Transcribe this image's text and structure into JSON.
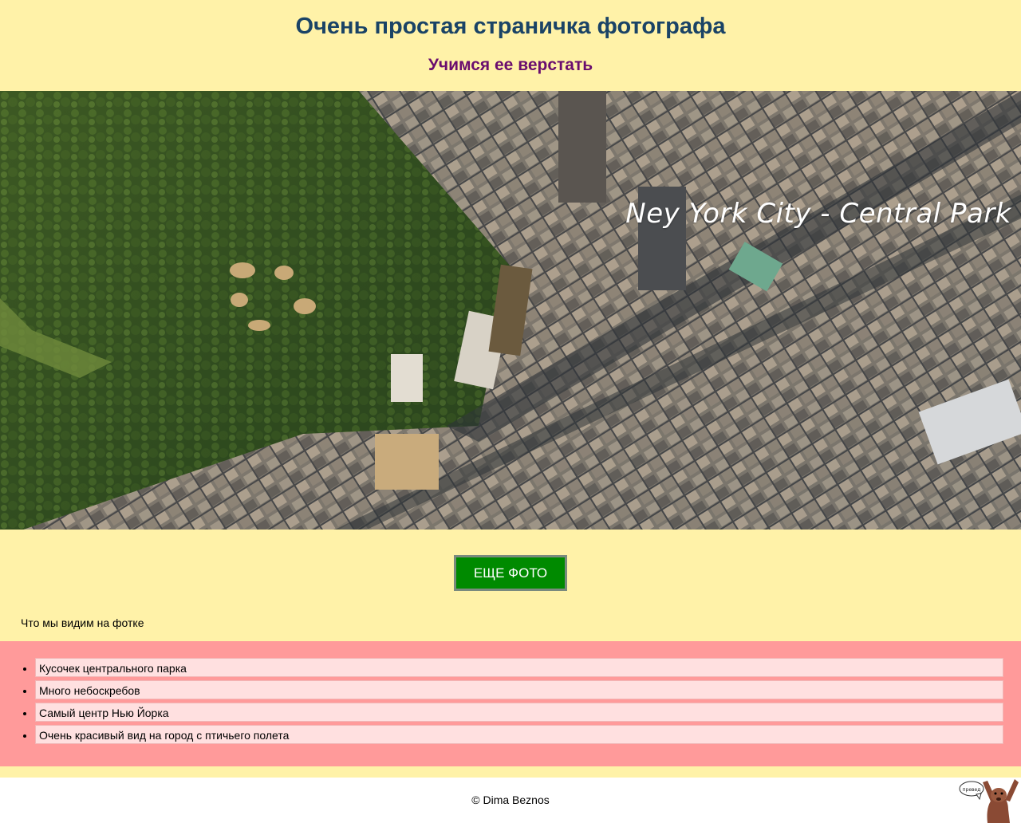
{
  "header": {
    "title": "Очень простая страничка фотографа",
    "subtitle": "Учимся ее верстать"
  },
  "hero": {
    "caption": "Ney York City - Central Park"
  },
  "actions": {
    "more_photos_label": "ЕЩЕ ФОТО"
  },
  "description": {
    "heading": "Что мы видим на фотке",
    "items": [
      "Кусочек центрального парка",
      "Много небоскребов",
      "Самый центр Нью Йорка",
      "Очень красивый вид на город с птичьего полета"
    ]
  },
  "footer": {
    "copyright": "© Dima Beznos",
    "mascot_bubble": "превед"
  },
  "colors": {
    "page_background": "#fff2a8",
    "title": "#1a4366",
    "subtitle": "#6a0d6e",
    "button": "#008a00",
    "list_background": "#ff9a9a",
    "list_item_background": "#ffe0e0"
  }
}
